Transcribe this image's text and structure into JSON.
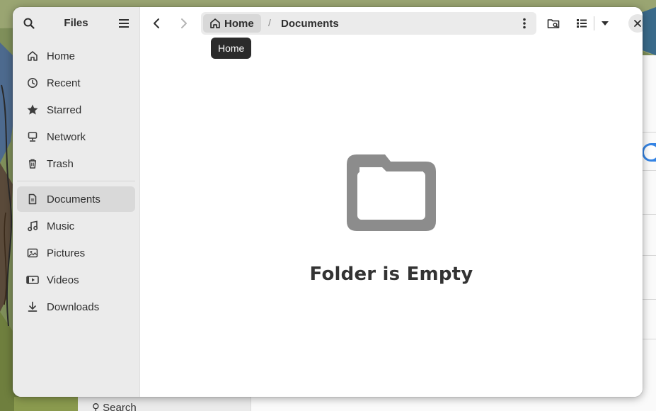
{
  "window": {
    "app_title": "Files",
    "tooltip": "Home"
  },
  "sidebar": {
    "places": [
      {
        "label": "Home",
        "icon": "home-icon"
      },
      {
        "label": "Recent",
        "icon": "clock-icon"
      },
      {
        "label": "Starred",
        "icon": "star-icon"
      },
      {
        "label": "Network",
        "icon": "network-icon"
      },
      {
        "label": "Trash",
        "icon": "trash-icon"
      }
    ],
    "bookmarks": [
      {
        "label": "Documents",
        "icon": "document-icon",
        "active": true
      },
      {
        "label": "Music",
        "icon": "music-icon"
      },
      {
        "label": "Pictures",
        "icon": "picture-icon"
      },
      {
        "label": "Videos",
        "icon": "video-icon"
      },
      {
        "label": "Downloads",
        "icon": "download-icon"
      }
    ]
  },
  "pathbar": {
    "home": "Home",
    "separator": "/",
    "current": "Documents"
  },
  "main": {
    "empty_message": "Folder is Empty"
  },
  "background": {
    "search_peek": "Search"
  },
  "colors": {
    "sidebar_bg": "#ebebeb",
    "active_item_bg": "#d9d9d9",
    "tooltip_bg": "#2b2b2b",
    "empty_icon": "#8c8c8c",
    "accent": "#3584e4"
  }
}
